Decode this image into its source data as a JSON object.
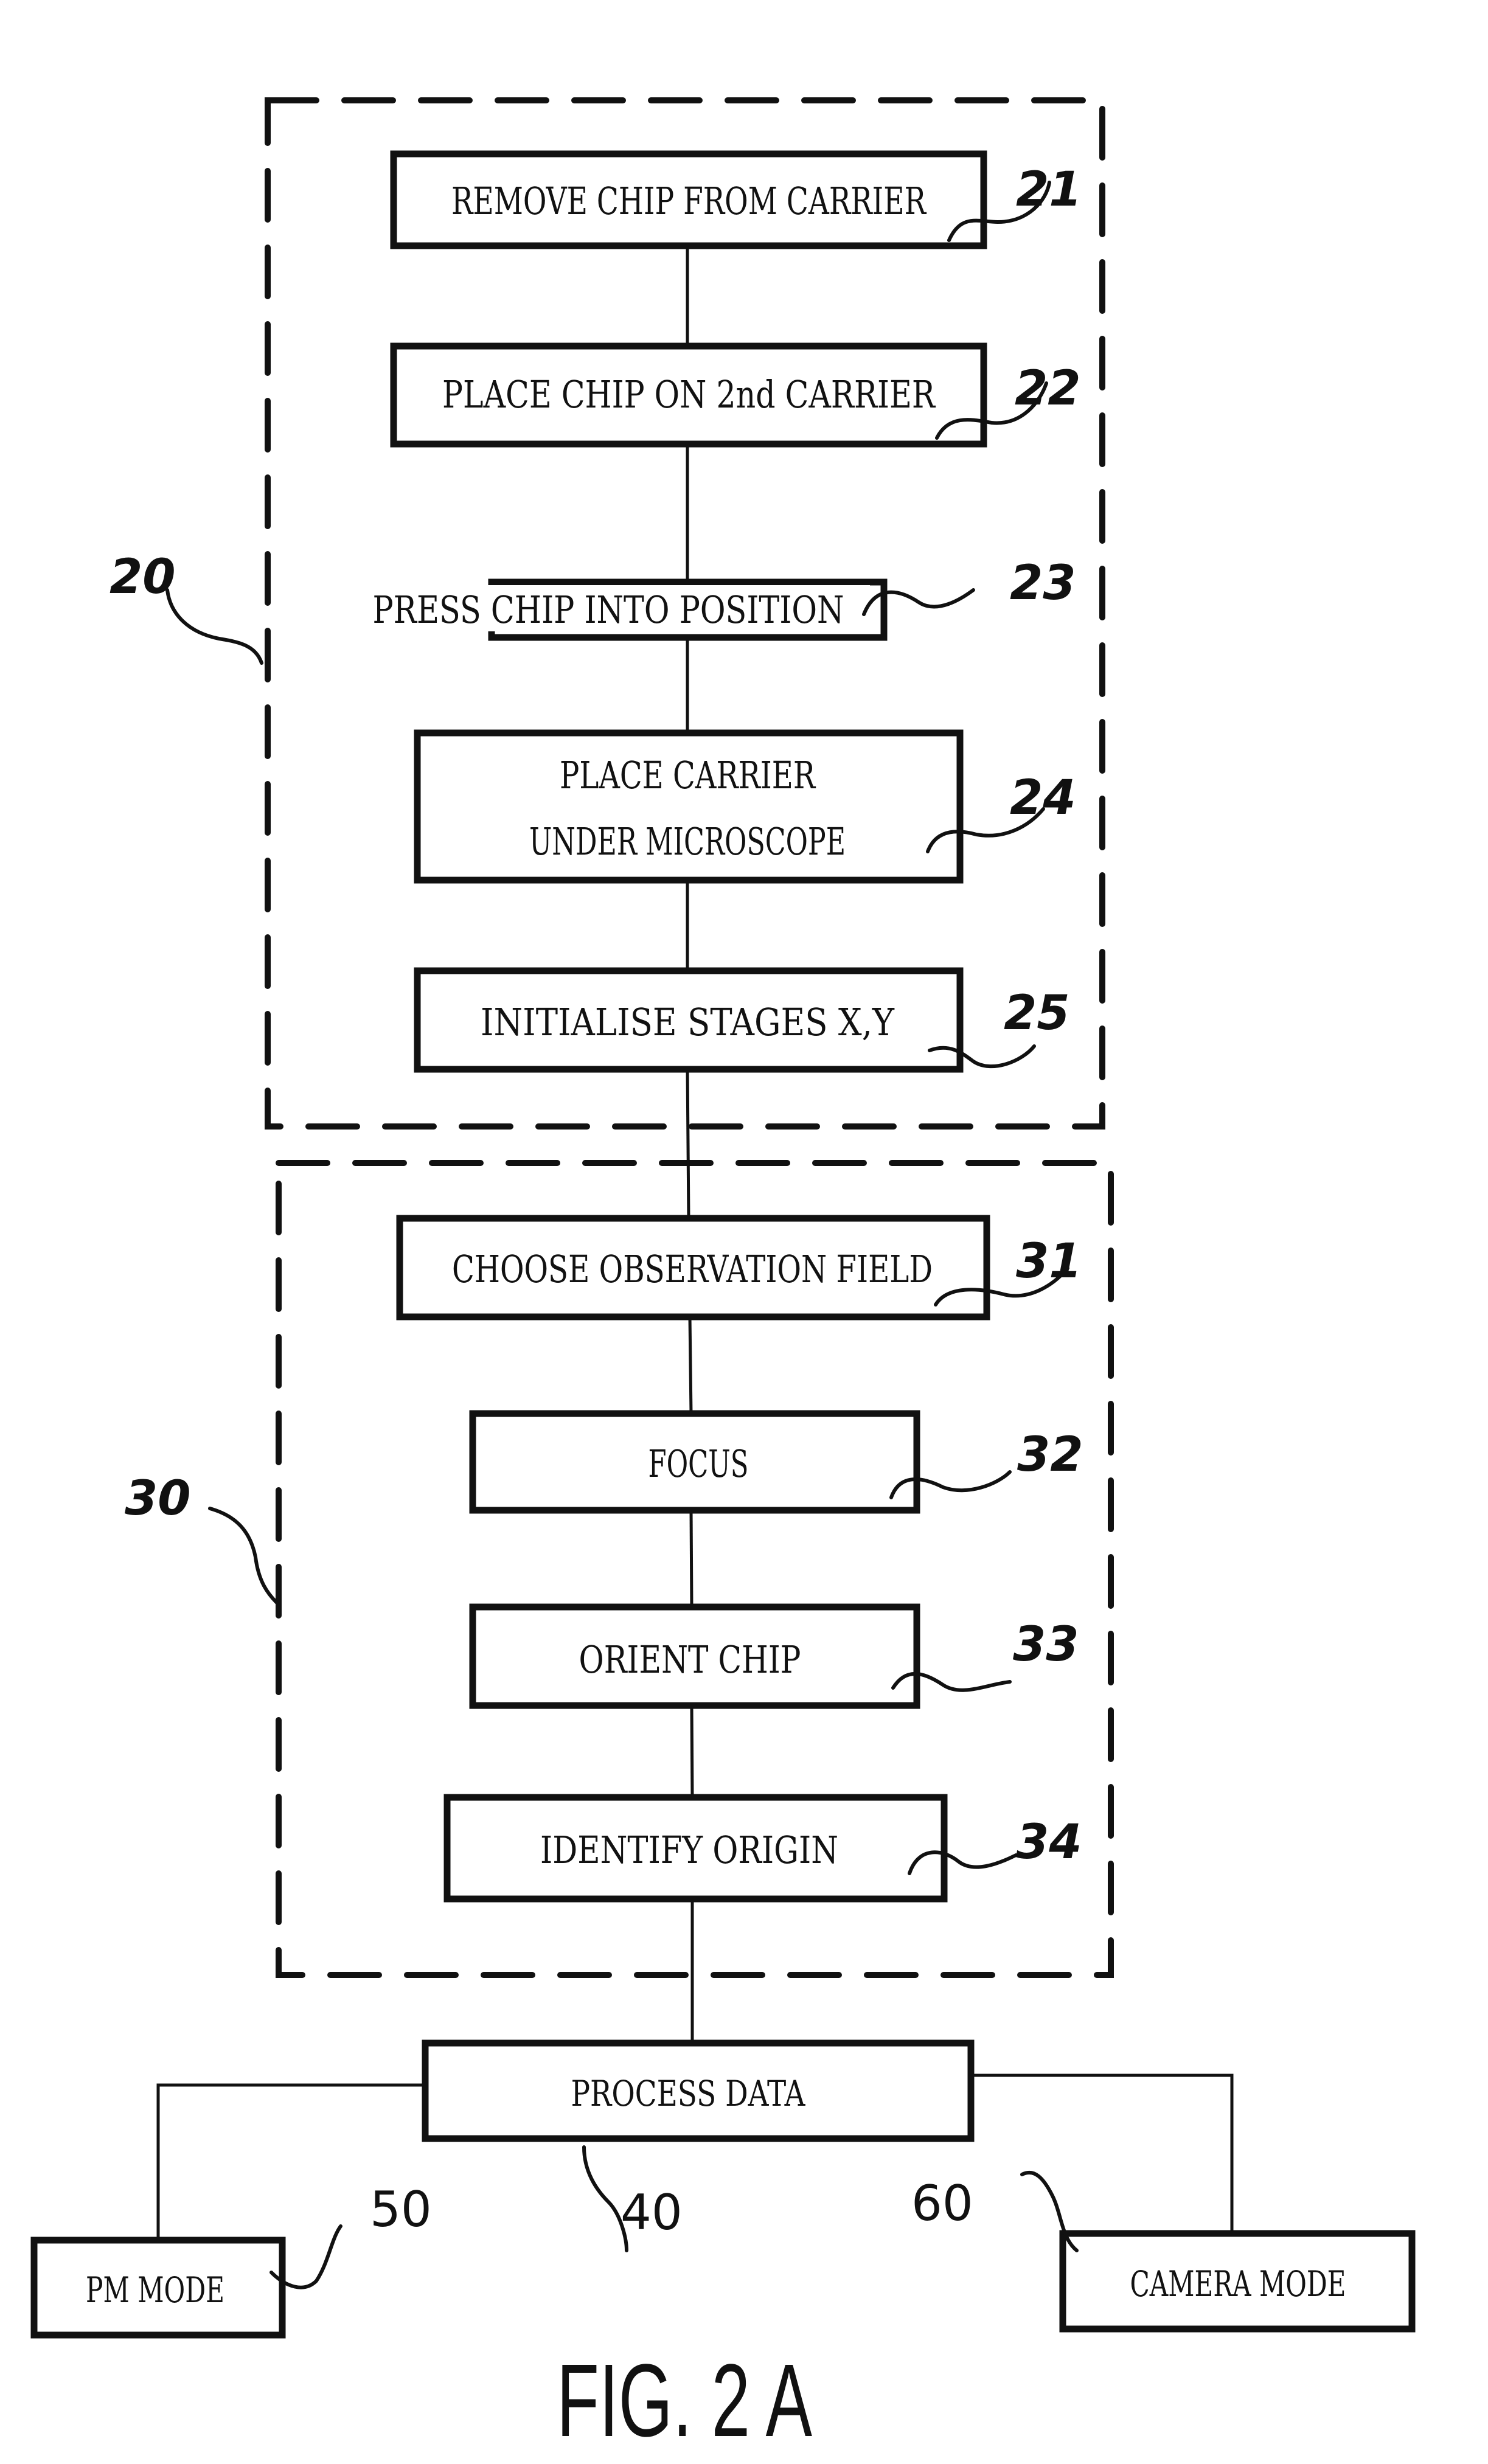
{
  "figure": {
    "title": "FIG. 2 A"
  },
  "groups": [
    {
      "ref": "20",
      "name": "chip-preparation-group"
    },
    {
      "ref": "30",
      "name": "alignment-group"
    }
  ],
  "steps": [
    {
      "ref": "21",
      "lines": [
        "REMOVE CHIP FROM CARRIER"
      ]
    },
    {
      "ref": "22",
      "lines": [
        "PLACE CHIP ON 2nd CARRIER"
      ]
    },
    {
      "ref": "23",
      "lines": [
        "PRESS CHIP INTO POSITION"
      ]
    },
    {
      "ref": "24",
      "lines": [
        "PLACE CARRIER",
        "UNDER MICROSCOPE"
      ]
    },
    {
      "ref": "25",
      "lines": [
        "INITIALISE STAGES X,Y"
      ]
    },
    {
      "ref": "31",
      "lines": [
        "CHOOSE OBSERVATION FIELD"
      ]
    },
    {
      "ref": "32",
      "lines": [
        "FOCUS"
      ]
    },
    {
      "ref": "33",
      "lines": [
        "ORIENT CHIP"
      ]
    },
    {
      "ref": "34",
      "lines": [
        "IDENTIFY ORIGIN"
      ]
    },
    {
      "ref": "40",
      "lines": [
        "PROCESS DATA"
      ]
    },
    {
      "ref": "50",
      "lines": [
        "PM MODE"
      ]
    },
    {
      "ref": "60",
      "lines": [
        "CAMERA MODE"
      ]
    }
  ]
}
